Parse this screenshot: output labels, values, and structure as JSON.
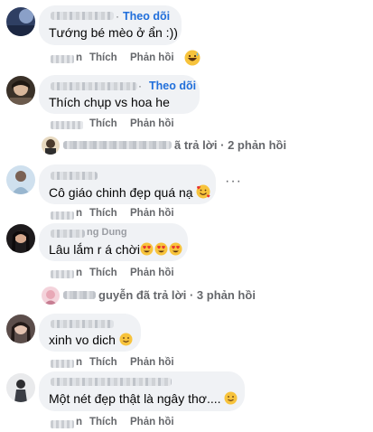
{
  "follow_label": "Theo dõi",
  "action_like": "Thích",
  "action_reply": "Phản hồi",
  "action_time_suffix": "n",
  "comments": [
    {
      "text": "Tướng bé mèo ở ẩn :))",
      "show_follow": true,
      "reaction": "grinning-sweat-emoji"
    },
    {
      "text": "Thích chụp vs hoa he",
      "show_follow": true
    },
    {
      "text": "Cô giáo chinh đẹp quá nạ",
      "trailing_emoji": "smiling-hearts-emoji",
      "more_label": "···"
    },
    {
      "text": "Lâu lắm r á chời",
      "trailing_emoji": "heart-eyes-emoji x3",
      "name_fragment": "ng Dung"
    },
    {
      "text": "xinh vo dich",
      "trailing_emoji": "slight-smile-emoji"
    },
    {
      "text": "Một nét đẹp thật là ngây thơ....",
      "trailing_emoji": "slight-smile-emoji"
    }
  ],
  "replies": [
    {
      "suffix": "ã trả lời · 2 phản hồi"
    },
    {
      "suffix": "guyễn đã trả lời · 3 phản hồi"
    }
  ]
}
